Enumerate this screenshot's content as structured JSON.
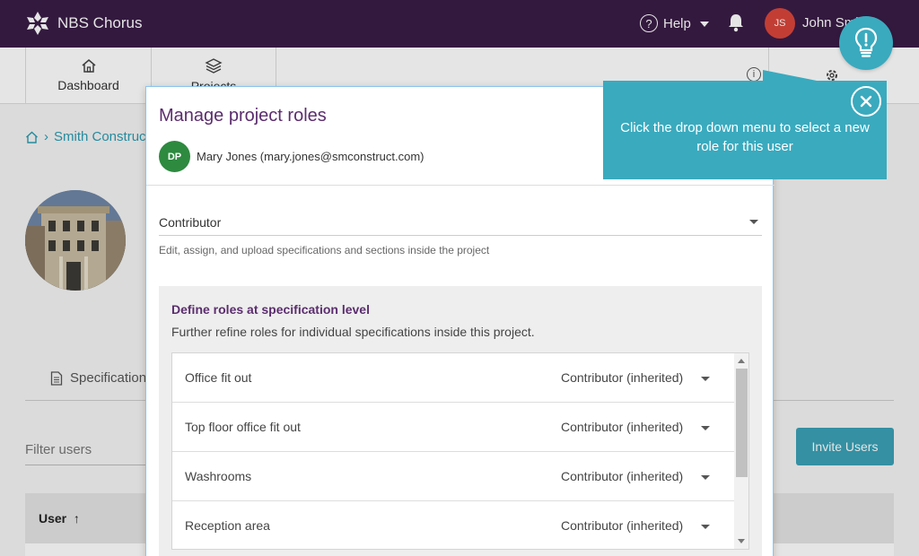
{
  "app": {
    "name": "NBS Chorus",
    "help_label": "Help",
    "user_initials": "JS",
    "user_name": "John Smith"
  },
  "subnav": {
    "dashboard_label": "Dashboard",
    "projects_label": "Projects"
  },
  "page": {
    "breadcrumb_project": "Smith Construct",
    "tab_label": "Specifications",
    "filter_placeholder": "Filter users",
    "invite_label": "Invite Users",
    "table_user_header": "User",
    "table_sort_arrow": "↑"
  },
  "modal": {
    "title": "Manage project roles",
    "user_initials": "DP",
    "user_text": "Mary Jones (mary.jones@smconstruct.com)",
    "role_value": "Contributor",
    "role_description": "Edit, assign, and upload specifications and sections inside the project",
    "spec_title": "Define roles at specification level",
    "spec_subtitle": "Further refine roles for individual specifications inside this project.",
    "specs": [
      {
        "name": "Office fit out",
        "role": "Contributor (inherited)"
      },
      {
        "name": "Top floor office fit out",
        "role": "Contributor (inherited)"
      },
      {
        "name": "Washrooms",
        "role": "Contributor (inherited)"
      },
      {
        "name": "Reception area",
        "role": "Contributor (inherited)"
      }
    ]
  },
  "tooltip": {
    "text": "Click the drop down menu to select a new role for this user"
  },
  "colors": {
    "topbar": "#3a1c47",
    "accent_teal": "#3aaabe",
    "modal_title": "#5b2d6e",
    "avatar_js": "#d9463a",
    "avatar_dp": "#2d8a3f"
  }
}
